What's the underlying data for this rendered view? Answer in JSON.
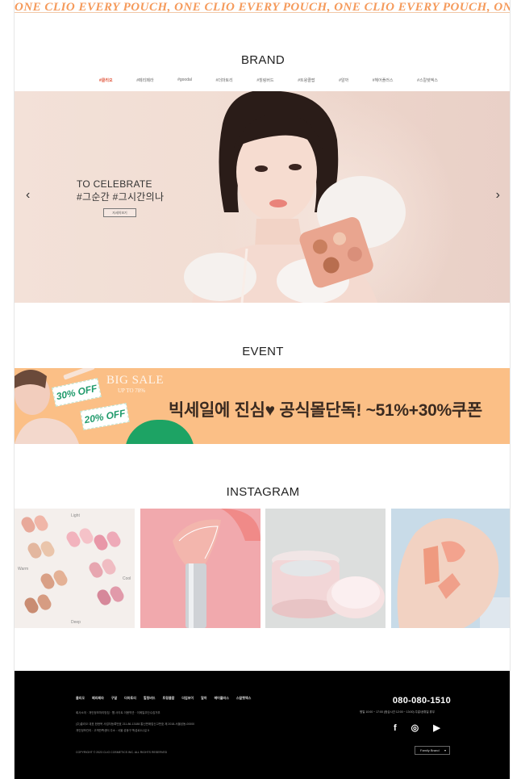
{
  "marquee": {
    "text": "ONE CLIO   EVERY POUCH, ONE CLIO   EVERY POUCH, ONE CLIO   EVERY POUCH, ONE"
  },
  "brand": {
    "title": "BRAND",
    "tabs": [
      "#클리오",
      "#페리페라",
      "#goodal",
      "#더마토리",
      "#힐링버드",
      "#트윙클팝",
      "#알까",
      "#헤어플러스",
      "#스칼렛엑스"
    ]
  },
  "hero": {
    "line1": "TO CELEBRATE",
    "line2": "#그순간 #그시간의나",
    "cta": "자세히보기",
    "prev_icon": "chevron-left-icon",
    "next_icon": "chevron-right-icon",
    "prev_glyph": "‹",
    "next_glyph": "›"
  },
  "event": {
    "title": "EVENT",
    "big_sale": "BIG SALE",
    "up_to": "UP TO 78%",
    "ticket1": "30% OFF",
    "ticket2": "20% OFF",
    "promo": "빅세일에 진심♥ 공식몰단독! ~51%+30%쿠폰"
  },
  "instagram": {
    "title": "INSTAGRAM",
    "tile1_labels": [
      "Light",
      "Warm",
      "Cool",
      "Deep"
    ]
  },
  "footer": {
    "nav": [
      "클리오",
      "페리페라",
      "구달",
      "더마토리",
      "힐링버드",
      "트윙클팝",
      "더업보이",
      "알까",
      "헤어플러스",
      "스칼렛엑스"
    ],
    "info1": "회사소개 · 개인정보처리방침 · 웹 사이트 이용약관 · 이메일무단수집거부",
    "info2": "(주)클리오  대표 한현옥  사업자등록번호 211-86-13188  통신판매업신고번호 제 2018-서울성동-00000",
    "info3": "개인정보관리 : 고객만족센터  주소 : 서울 성동구 뚝섬로1나길 5",
    "copyright": "COPYRIGHT © 2023 CLIO COSMETICS INC. ALL RIGHTS RESERVED",
    "phone": "080-080-1510",
    "hours": "평일 10:00 ~ 17:00 (점심시간 12:00 ~ 13:00) 주말/공휴일 휴무",
    "social": [
      {
        "icon": "facebook-icon",
        "glyph": "f"
      },
      {
        "icon": "instagram-icon",
        "glyph": "◎"
      },
      {
        "icon": "youtube-icon",
        "glyph": "▶"
      }
    ],
    "family_site": "Family Brand"
  }
}
